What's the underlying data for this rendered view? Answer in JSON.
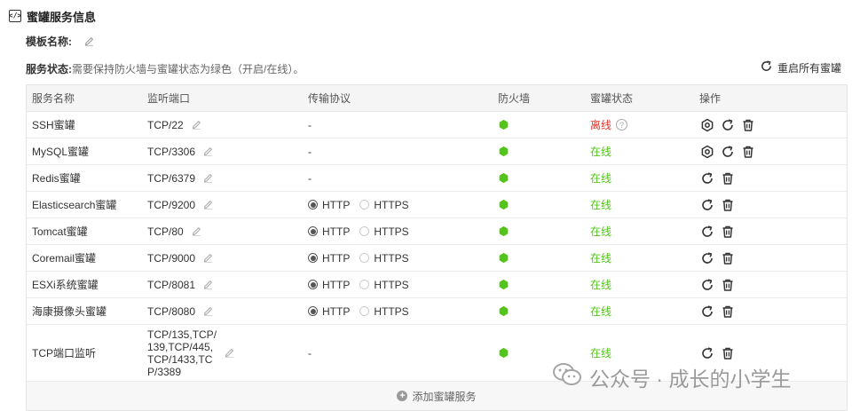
{
  "section": {
    "title": "蜜罐服务信息",
    "icon": "code-icon"
  },
  "template": {
    "label": "模板名称:",
    "value": ""
  },
  "service_status": {
    "label": "服务状态:",
    "description": "需要保持防火墙与蜜罐状态为绿色（开启/在线）。"
  },
  "restart_all": {
    "label": "重启所有蜜罐"
  },
  "colors": {
    "online": "#52c41a",
    "offline": "#e0342a",
    "firewall_on": "#52c41a"
  },
  "table": {
    "headers": [
      "服务名称",
      "监听端口",
      "传输协议",
      "防火墙",
      "蜜罐状态",
      "操作"
    ],
    "rows": [
      {
        "name": "SSH蜜罐",
        "port": "TCP/22",
        "protocol": "-",
        "firewall": "on",
        "state": "离线",
        "state_type": "offline",
        "help": true,
        "actions": [
          "config",
          "restart",
          "delete"
        ]
      },
      {
        "name": "MySQL蜜罐",
        "port": "TCP/3306",
        "protocol": "-",
        "firewall": "on",
        "state": "在线",
        "state_type": "online",
        "help": false,
        "actions": [
          "config",
          "restart",
          "delete"
        ]
      },
      {
        "name": "Redis蜜罐",
        "port": "TCP/6379",
        "protocol": "-",
        "firewall": "on",
        "state": "在线",
        "state_type": "online",
        "help": false,
        "actions": [
          "restart",
          "delete"
        ]
      },
      {
        "name": "Elasticsearch蜜罐",
        "port": "TCP/9200",
        "protocol": "radio",
        "selected": "HTTP",
        "options": [
          "HTTP",
          "HTTPS"
        ],
        "firewall": "on",
        "state": "在线",
        "state_type": "online",
        "help": false,
        "actions": [
          "restart",
          "delete"
        ]
      },
      {
        "name": "Tomcat蜜罐",
        "port": "TCP/80",
        "protocol": "radio",
        "selected": "HTTP",
        "options": [
          "HTTP",
          "HTTPS"
        ],
        "firewall": "on",
        "state": "在线",
        "state_type": "online",
        "help": false,
        "actions": [
          "restart",
          "delete"
        ]
      },
      {
        "name": "Coremail蜜罐",
        "port": "TCP/9000",
        "protocol": "radio",
        "selected": "HTTP",
        "options": [
          "HTTP",
          "HTTPS"
        ],
        "firewall": "on",
        "state": "在线",
        "state_type": "online",
        "help": false,
        "actions": [
          "restart",
          "delete"
        ]
      },
      {
        "name": "ESXi系统蜜罐",
        "port": "TCP/8081",
        "protocol": "radio",
        "selected": "HTTP",
        "options": [
          "HTTP",
          "HTTPS"
        ],
        "firewall": "on",
        "state": "在线",
        "state_type": "online",
        "help": false,
        "actions": [
          "restart",
          "delete"
        ]
      },
      {
        "name": "海康摄像头蜜罐",
        "port": "TCP/8080",
        "protocol": "radio",
        "selected": "HTTP",
        "options": [
          "HTTP",
          "HTTPS"
        ],
        "firewall": "on",
        "state": "在线",
        "state_type": "online",
        "help": false,
        "actions": [
          "restart",
          "delete"
        ]
      },
      {
        "name": "TCP端口监听",
        "port_lines": [
          "TCP/135,TCP/",
          "139,TCP/445,",
          "TCP/1433,TC",
          "P/3389"
        ],
        "protocol": "-",
        "firewall": "on",
        "state": "在线",
        "state_type": "online",
        "help": false,
        "actions": [
          "restart",
          "delete"
        ]
      }
    ],
    "add_label": "添加蜜罐服务"
  },
  "watermark": {
    "text": "公众号 · 成长的小学生",
    "icon": "wechat-logo-icon"
  }
}
